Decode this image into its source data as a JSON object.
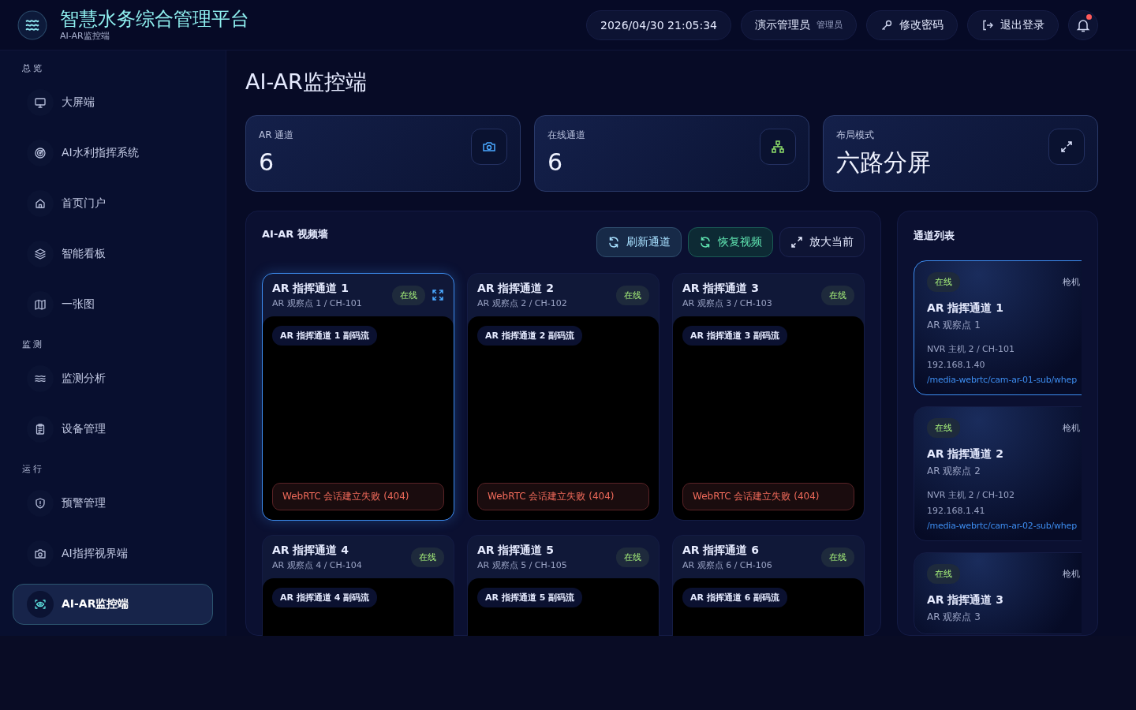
{
  "header": {
    "title": "智慧水务综合管理平台",
    "subtitle": "AI-AR监控端",
    "datetime": "2026/04/30 21:05:34",
    "user": {
      "name": "演示管理员",
      "role": "管理员"
    },
    "buttons": [
      {
        "label": "修改密码",
        "kind": "key"
      },
      {
        "label": "退出登录",
        "kind": "logout"
      }
    ],
    "notification": {
      "unread": true
    }
  },
  "sidebar": {
    "groups": [
      {
        "label": "总 览",
        "items": [
          {
            "label": "大屏端",
            "selected": false
          },
          {
            "label": "AI水利指挥系统",
            "selected": false
          },
          {
            "label": "首页门户",
            "selected": false
          },
          {
            "label": "智能看板",
            "selected": false
          },
          {
            "label": "一张图",
            "selected": false
          }
        ]
      },
      {
        "label": "监 测",
        "items": [
          {
            "label": "监测分析",
            "selected": false
          },
          {
            "label": "设备管理",
            "selected": false
          }
        ]
      },
      {
        "label": "运 行",
        "items": [
          {
            "label": "预警管理",
            "selected": false
          },
          {
            "label": "AI指挥视界端",
            "selected": false
          },
          {
            "label": "AI-AR监控端",
            "selected": true
          }
        ]
      }
    ]
  },
  "page_title": "AI-AR监控端",
  "stats": [
    {
      "label": "AR 通道",
      "value": "6"
    },
    {
      "label": "在线通道",
      "value": "6"
    },
    {
      "label": "布局模式",
      "value": "六路分屏"
    }
  ],
  "video_wall": {
    "title": "AI-AR 视频墙",
    "actions": [
      {
        "label": "刷新通道",
        "kind": "refresh"
      },
      {
        "label": "恢复视频",
        "kind": "restore"
      },
      {
        "label": "放大当前",
        "kind": "expand"
      }
    ],
    "tiles": [
      {
        "title": "AR 指挥通道 1",
        "subtitle": "AR 观察点 1 / CH-101",
        "status": "在线",
        "stream": "AR 指挥通道 1 副码流",
        "error": "WebRTC 会话建立失败 (404)",
        "selected": true
      },
      {
        "title": "AR 指挥通道 2",
        "subtitle": "AR 观察点 2 / CH-102",
        "status": "在线",
        "stream": "AR 指挥通道 2 副码流",
        "error": "WebRTC 会话建立失败 (404)",
        "selected": false
      },
      {
        "title": "AR 指挥通道 3",
        "subtitle": "AR 观察点 3 / CH-103",
        "status": "在线",
        "stream": "AR 指挥通道 3 副码流",
        "error": "WebRTC 会话建立失败 (404)",
        "selected": false
      },
      {
        "title": "AR 指挥通道 4",
        "subtitle": "AR 观察点 4 / CH-104",
        "status": "在线",
        "stream": "AR 指挥通道 4 副码流",
        "selected": false
      },
      {
        "title": "AR 指挥通道 5",
        "subtitle": "AR 观察点 5 / CH-105",
        "status": "在线",
        "stream": "AR 指挥通道 5 副码流",
        "selected": false
      },
      {
        "title": "AR 指挥通道 6",
        "subtitle": "AR 观察点 6 / CH-106",
        "status": "在线",
        "stream": "AR 指挥通道 6 副码流",
        "selected": false
      }
    ]
  },
  "channel_list": {
    "title": "通道列表",
    "items": [
      {
        "status": "在线",
        "type": "枪机",
        "title": "AR 指挥通道 1",
        "point": "AR 观察点 1",
        "nvr": "NVR 主机 2 / CH-101",
        "ip": "192.168.1.40",
        "url": "/media-webrtc/cam-ar-01-sub/whep",
        "selected": true
      },
      {
        "status": "在线",
        "type": "枪机",
        "title": "AR 指挥通道 2",
        "point": "AR 观察点 2",
        "nvr": "NVR 主机 2 / CH-102",
        "ip": "192.168.1.41",
        "url": "/media-webrtc/cam-ar-02-sub/whep",
        "selected": false
      },
      {
        "status": "在线",
        "type": "枪机",
        "title": "AR 指挥通道 3",
        "point": "AR 观察点 3",
        "selected": false
      }
    ]
  }
}
